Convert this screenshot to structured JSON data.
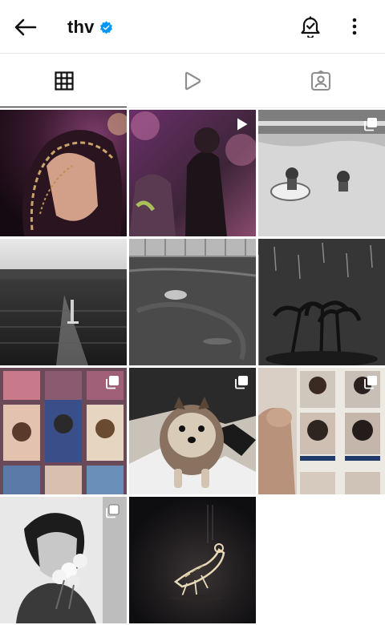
{
  "header": {
    "username": "thv",
    "back_icon": "arrow-left-icon",
    "verified_icon": "verified-badge-icon",
    "notify_icon": "bell-check-icon",
    "more_icon": "more-vertical-icon"
  },
  "tabs": [
    {
      "name": "posts",
      "icon": "grid-icon",
      "active": true
    },
    {
      "name": "reels",
      "icon": "play-icon",
      "active": false
    },
    {
      "name": "tagged",
      "icon": "tagged-person-icon",
      "active": false
    }
  ],
  "colors": {
    "verified": "#0095f6",
    "text": "#111111",
    "divider": "#e6e6e6"
  },
  "posts": [
    {
      "id": "post-1",
      "overlay": "none"
    },
    {
      "id": "post-2",
      "overlay": "reel"
    },
    {
      "id": "post-3",
      "overlay": "carousel"
    },
    {
      "id": "post-4",
      "overlay": "none"
    },
    {
      "id": "post-5",
      "overlay": "none"
    },
    {
      "id": "post-6",
      "overlay": "none"
    },
    {
      "id": "post-7",
      "overlay": "carousel"
    },
    {
      "id": "post-8",
      "overlay": "carousel"
    },
    {
      "id": "post-9",
      "overlay": "carousel"
    },
    {
      "id": "post-10",
      "overlay": "carousel"
    },
    {
      "id": "post-11",
      "overlay": "none"
    }
  ]
}
